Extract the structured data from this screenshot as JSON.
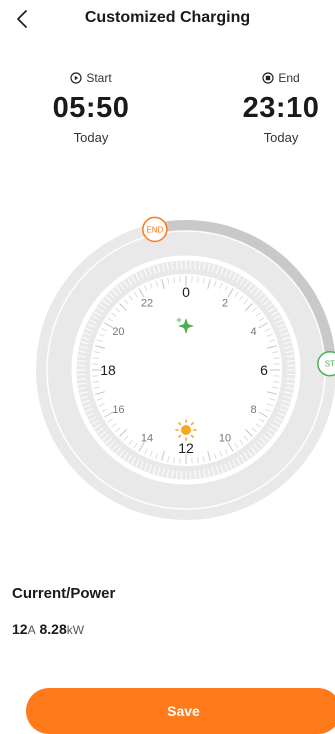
{
  "header": {
    "title": "Customized Charging",
    "back_icon": "chevron-left-icon"
  },
  "schedule": {
    "start": {
      "label": "Start",
      "time": "05:50",
      "day": "Today",
      "icon": "play-circle-icon"
    },
    "end": {
      "label": "End",
      "time": "23:10",
      "day": "Today",
      "icon": "stop-circle-icon"
    }
  },
  "dial": {
    "hour_labels": [
      "0",
      "2",
      "4",
      "6",
      "8",
      "10",
      "12",
      "14",
      "16",
      "18",
      "20",
      "22"
    ],
    "start_marker": "ST",
    "end_marker": "END",
    "start_hour": 5.833,
    "end_hour": 23.167,
    "night_icon": "sparkle-icon",
    "day_icon": "sun-icon",
    "colors": {
      "accent": "#ff7a1a",
      "start": "#4caf50",
      "track": "#e6e6e6",
      "selected": "#c9c9c9"
    }
  },
  "power": {
    "title": "Current/Power",
    "current": "12",
    "current_unit": "A",
    "power": "8.28",
    "power_unit": "kW"
  },
  "actions": {
    "save_label": "Save"
  }
}
